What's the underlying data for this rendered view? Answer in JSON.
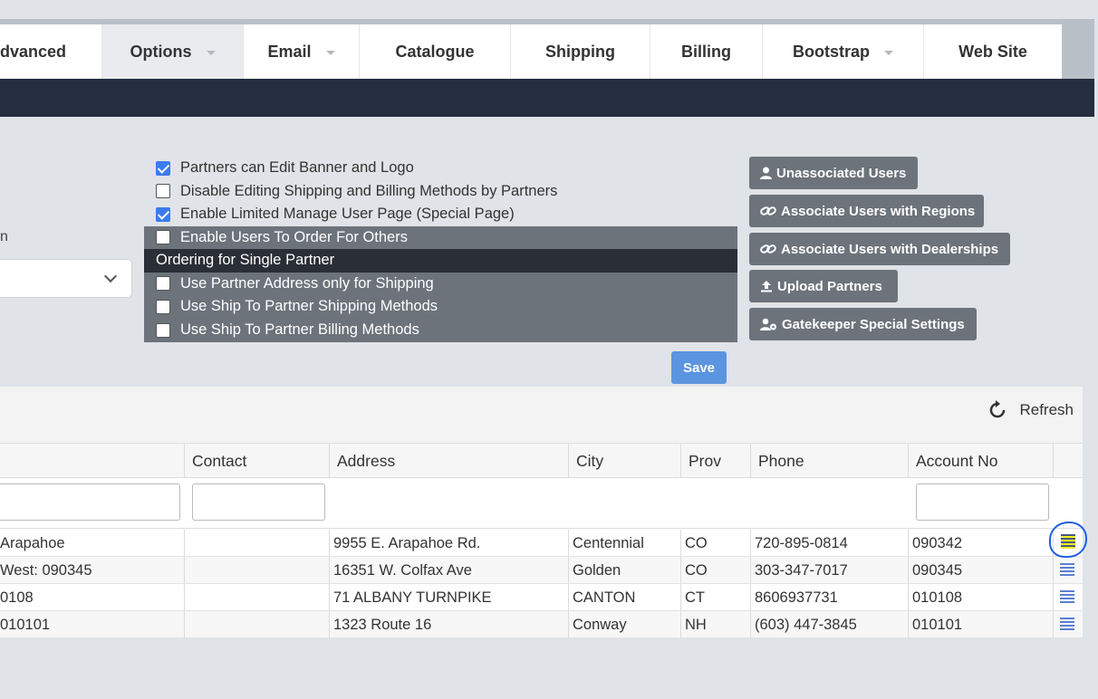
{
  "tabs": [
    {
      "label": "dvanced",
      "caret": false,
      "active": false
    },
    {
      "label": "Options",
      "caret": true,
      "active": true
    },
    {
      "label": "Email",
      "caret": true,
      "active": false
    },
    {
      "label": "Catalogue",
      "caret": false,
      "active": false
    },
    {
      "label": "Shipping",
      "caret": false,
      "active": false
    },
    {
      "label": "Billing",
      "caret": false,
      "active": false
    },
    {
      "label": "Bootstrap",
      "caret": true,
      "active": false
    },
    {
      "label": "Web Site",
      "caret": false,
      "active": false
    }
  ],
  "left": {
    "partial_label": "n"
  },
  "options": [
    {
      "label": "Partners can Edit Banner and Logo",
      "checked": true
    },
    {
      "label": "Disable Editing Shipping and Billing Methods by Partners",
      "checked": false
    },
    {
      "label": "Enable Limited Manage User Page (Special Page)",
      "checked": true
    },
    {
      "label": "Enable Users To Order For Others",
      "checked": false
    },
    {
      "label": "Ordering for Single Partner"
    },
    {
      "label": "Use Partner Address only for Shipping",
      "checked": false
    },
    {
      "label": "Use Ship To Partner Shipping Methods",
      "checked": false
    },
    {
      "label": "Use Ship To Partner Billing Methods",
      "checked": false
    }
  ],
  "actions": [
    {
      "label": "Unassociated Users",
      "icon": "user-icon"
    },
    {
      "label": "Associate Users with Regions",
      "icon": "link-icon"
    },
    {
      "label": "Associate Users with Dealerships",
      "icon": "link-icon"
    },
    {
      "label": "Upload Partners",
      "icon": "upload-icon"
    },
    {
      "label": "Gatekeeper Special Settings",
      "icon": "users-gear-icon"
    }
  ],
  "save_label": "Save",
  "grid": {
    "refresh_label": "Refresh",
    "columns": [
      "Contact",
      "Address",
      "City",
      "Prov",
      "Phone",
      "Account No"
    ],
    "rows": [
      {
        "name": "Arapahoe",
        "contact": "",
        "address": "9955 E. Arapahoe Rd.",
        "city": "Centennial",
        "prov": "CO",
        "phone": "720-895-0814",
        "account": "090342"
      },
      {
        "name": "West: 090345",
        "contact": "",
        "address": "16351 W. Colfax Ave",
        "city": "Golden",
        "prov": "CO",
        "phone": "303-347-7017",
        "account": "090345"
      },
      {
        "name": "0108",
        "contact": "",
        "address": "71 ALBANY TURNPIKE",
        "city": "CANTON",
        "prov": "CT",
        "phone": "8606937731",
        "account": "010108"
      },
      {
        "name": "010101",
        "contact": "",
        "address": "1323 Route 16",
        "city": "Conway",
        "prov": "NH",
        "phone": "(603) 447-3845",
        "account": "010101"
      }
    ]
  },
  "colors": {
    "dark_bar": "#252d40",
    "button_grey": "#6c737b",
    "save_blue": "#5b94e0",
    "checkbox_blue": "#3a7bf0",
    "highlight": "#f3f021"
  }
}
